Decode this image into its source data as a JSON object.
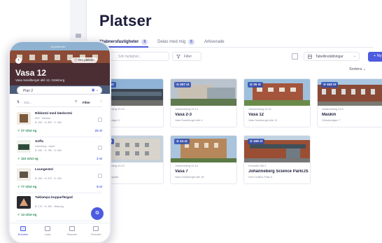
{
  "app": {
    "title": "Platser",
    "tabs": [
      {
        "label": "Ytabnersfastigheter",
        "count": "9"
      },
      {
        "label": "Delas med mig",
        "count": "5"
      },
      {
        "label": "Arkiverade",
        "count": ""
      }
    ],
    "toolbar": {
      "search_placeholder": "Sök fastighet...",
      "filter_label": "Filter",
      "settings_label": "Tabellinställningar",
      "new_label": "+ Ny plats",
      "sort_label": "Sortera"
    },
    "cards": [
      {
        "tag": "⊙ 12 st",
        "meta": "Johanneberg 31:15",
        "name": "Uset",
        "addr": "Hörsalsvägen 1"
      },
      {
        "tag": "⊙ 257 st",
        "meta": "Johanneberg 31:13",
        "name": "Vasa 2-3",
        "addr": "Vasa Sandberget allé 4"
      },
      {
        "tag": "⊙ 26 st",
        "meta": "Johanneberg 31:15",
        "name": "Vasa 12",
        "addr": "Vasa Sandberget allé 12"
      },
      {
        "tag": "⊙ 442 st",
        "meta": "Johanneberg 31:8",
        "name": "Maskin",
        "addr": "Hörsalsvägen 7"
      },
      {
        "tag": "⊙ 6 st",
        "meta": "Johanneberg 31:10",
        "name": "1",
        "addr": "Gibraltargatan"
      },
      {
        "tag": "⊙ 14 st",
        "meta": "Johanneberg 31:16",
        "name": "Vasa 7",
        "addr": "Vasa Sandberget allé 18"
      },
      {
        "tag": "⊙ 168 st",
        "meta": "Krokslätt 185:2",
        "name": "Johanneberg Science Park/JSP",
        "addr": "Sven Hultins Plats 5"
      }
    ]
  },
  "phone": {
    "status_note": "Uppdaterad",
    "back_icon": "arrow-left-icon",
    "about_label": "ⓘ Om platsen",
    "place_title": "Vasa 12",
    "place_address": "Vasa Sandberget allé 12, Göteborg",
    "floor_label": "Plan 2",
    "search_label": "Sök...",
    "filter_label": "Filter",
    "more_label": "⋮",
    "items": [
      {
        "title": "Ribbstol med bänkrotsi",
        "sub": "MIO · Mardan",
        "price": "B: 260 · H: 890 · D: 360",
        "qty": "27 st/ut eg",
        "badge": "22 st"
      },
      {
        "title": "Soffa",
        "sub": "Lanerburg · Apart",
        "price": "B: 250 · H: 780 · D: 800",
        "qty": "110 st/ut eg",
        "badge": "2 st"
      },
      {
        "title": "Loungestol",
        "sub": "",
        "price": "B: 260 · H: 670 · D: 250",
        "qty": "77 st/ut eg",
        "badge": "6 st"
      },
      {
        "title": "Taklampa kopparfärgad",
        "sub": "",
        "price": "B: 170 · H: 280 · Mässing",
        "qty": "14 st/ut eg",
        "badge": "12 st"
      }
    ],
    "tabbar": [
      {
        "label": "Bokabel"
      },
      {
        "label": "Lista"
      },
      {
        "label": "Skanner"
      },
      {
        "label": "Översikt"
      }
    ]
  },
  "colors": {
    "accent": "#4d5be0",
    "text_dark": "#1e1f3a",
    "stock_green": "#2a8a55"
  }
}
